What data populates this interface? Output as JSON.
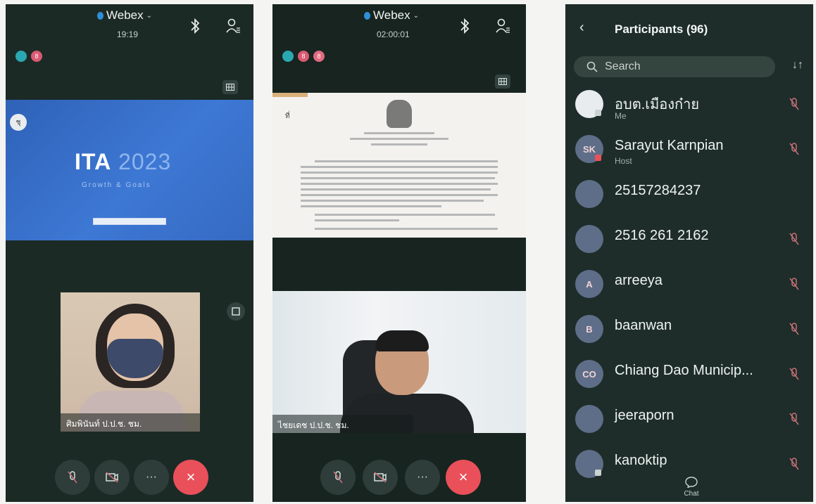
{
  "colors": {
    "accent_red": "#e9505a",
    "share_blue": "#3d78d4",
    "mic_muted": "#c9707a"
  },
  "screen1": {
    "app": "Webex",
    "timer": "19:19",
    "avatar_badges": [
      "",
      "8"
    ],
    "share": {
      "badge": "ชุ",
      "title_bold": "ITA",
      "title_light": "2023",
      "subtitle": "Growth & Goals"
    },
    "video_name": "ศิมพินันท์ ป.ป.ช. ชม.",
    "controls": [
      "mute-icon",
      "camera-off-icon",
      "more-icon",
      "end-call-icon"
    ],
    "more_label": "···",
    "end_label": "×"
  },
  "screen2": {
    "app": "Webex",
    "timer": "02:00:01",
    "avatar_badges": [
      "",
      "8",
      "8"
    ],
    "doc_mark": "ที่",
    "video_name": "ไชยเดช ป.ป.ช. ชม.",
    "more_label": "···",
    "end_label": "×"
  },
  "screen3": {
    "title": "Participants (96)",
    "back": "‹",
    "search_placeholder": "Search",
    "sort": "↓↑",
    "participants": [
      {
        "name": "อบต.เมืองก๋าย",
        "role": "Me",
        "initials": ""
      },
      {
        "name": "Sarayut Karnpian",
        "role": "Host",
        "initials": "SK"
      },
      {
        "name": "25157284237",
        "role": "",
        "initials": ""
      },
      {
        "name": "2516 261 2162",
        "role": "",
        "initials": ""
      },
      {
        "name": "arreeya",
        "role": "",
        "initials": "A"
      },
      {
        "name": "baanwan",
        "role": "",
        "initials": "B"
      },
      {
        "name": "Chiang Dao Municip...",
        "role": "",
        "initials": "CO"
      },
      {
        "name": "jeeraporn",
        "role": "",
        "initials": ""
      },
      {
        "name": "kanoktip",
        "role": "",
        "initials": ""
      }
    ],
    "chat_label": "Chat"
  }
}
